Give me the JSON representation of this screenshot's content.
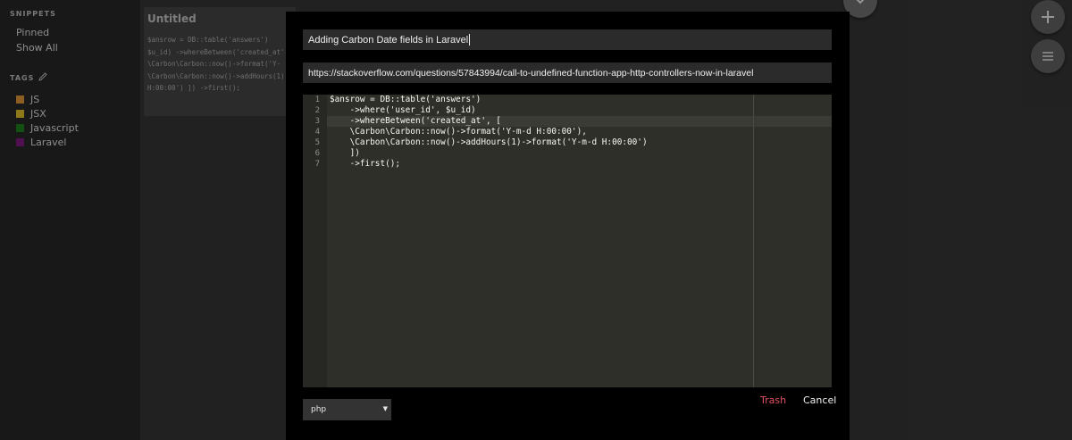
{
  "sidebar": {
    "snippets_heading": "SNIPPETS",
    "pinned_label": "Pinned",
    "show_all_label": "Show All",
    "tags_heading": "TAGS",
    "tags": [
      {
        "label": "JS",
        "color": "#f2a23a"
      },
      {
        "label": "JSX",
        "color": "#f5d02a"
      },
      {
        "label": "Javascript",
        "color": "#1e8a1e"
      },
      {
        "label": "Laravel",
        "color": "#8a1a8a"
      }
    ]
  },
  "background_card": {
    "title": "Untitled",
    "preview": "$ansrow = DB::table('answers')\n$u_id) ->whereBetween('created_at'\n\\Carbon\\Carbon::now()->format('Y-\n\\Carbon\\Carbon::now()->addHours(1)\nH:00:00') ]) ->first();"
  },
  "modal": {
    "title_value": "Adding Carbon Date fields in Laravel",
    "url_value": "https://stackoverflow.com/questions/57843994/call-to-undefined-function-app-http-controllers-now-in-laravel",
    "code_lines": [
      "$ansrow = DB::table('answers')",
      "    ->where('user_id', $u_id)",
      "    ->whereBetween('created_at', [",
      "    \\Carbon\\Carbon::now()->format('Y-m-d H:00:00'),",
      "    \\Carbon\\Carbon::now()->addHours(1)->format('Y-m-d H:00:00')",
      "    ])",
      "    ->first();"
    ],
    "line_numbers": [
      "1",
      "2",
      "3",
      "4",
      "5",
      "6",
      "7"
    ],
    "language_value": "php",
    "trash_label": "Trash",
    "cancel_label": "Cancel"
  },
  "icons": {
    "add": "plus-icon",
    "menu": "menu-icon",
    "edit_tags": "pencil-icon",
    "collapse": "chevron-down-icon"
  },
  "colors": {
    "trash": "#e05060",
    "modal_bg": "#000000"
  }
}
